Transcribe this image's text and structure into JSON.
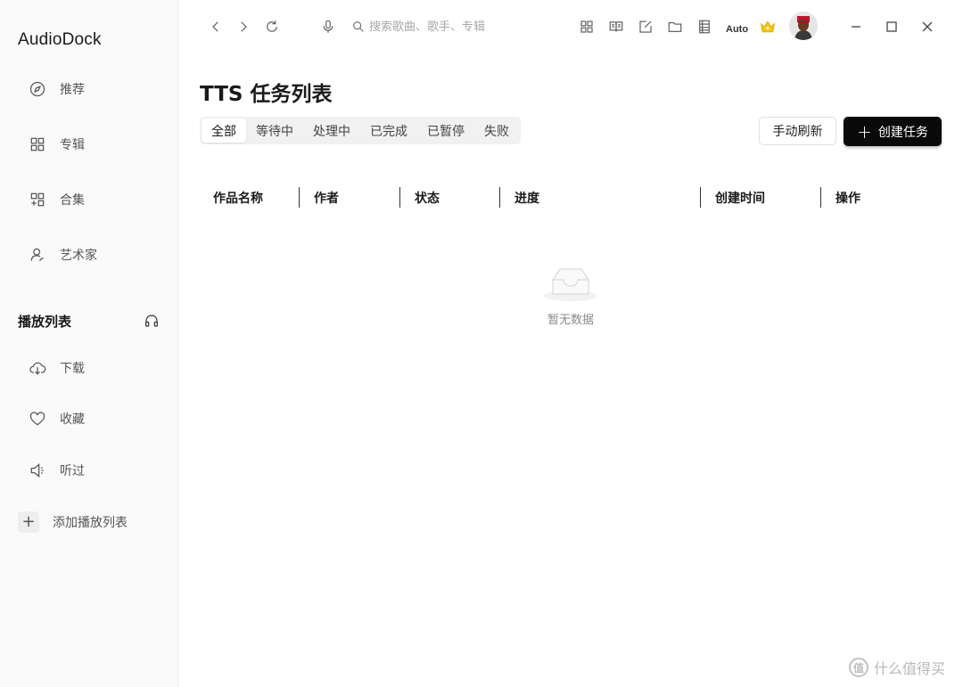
{
  "app": {
    "title": "AudioDock"
  },
  "sidebar": {
    "items": [
      {
        "label": "推荐",
        "icon": "compass-icon"
      },
      {
        "label": "专辑",
        "icon": "grid-icon"
      },
      {
        "label": "合集",
        "icon": "collection-icon"
      },
      {
        "label": "艺术家",
        "icon": "artist-icon"
      }
    ],
    "playlist_title": "播放列表",
    "playlist_icon": "headphones-icon",
    "playlist_items": [
      {
        "label": "下载",
        "icon": "cloud-download-icon"
      },
      {
        "label": "收藏",
        "icon": "heart-icon"
      },
      {
        "label": "听过",
        "icon": "speaker-icon"
      }
    ],
    "add_playlist_label": "添加播放列表"
  },
  "topbar": {
    "search_placeholder": "搜索歌曲、歌手、专辑",
    "auto_label": "Auto"
  },
  "main": {
    "page_title": "TTS 任务列表",
    "tabs": [
      {
        "label": "全部",
        "active": true
      },
      {
        "label": "等待中",
        "active": false
      },
      {
        "label": "处理中",
        "active": false
      },
      {
        "label": "已完成",
        "active": false
      },
      {
        "label": "已暂停",
        "active": false
      },
      {
        "label": "失败",
        "active": false
      }
    ],
    "refresh_label": "手动刷新",
    "create_label": "创建任务",
    "columns": [
      "作品名称",
      "作者",
      "状态",
      "进度",
      "创建时间",
      "操作"
    ],
    "empty_text": "暂无数据"
  },
  "watermark": {
    "text": "什么值得买",
    "icon_text": "值"
  },
  "colors": {
    "primary_button": "#0a0a0a",
    "crown": "#f5c518",
    "sidebar_bg": "#fafafa"
  }
}
